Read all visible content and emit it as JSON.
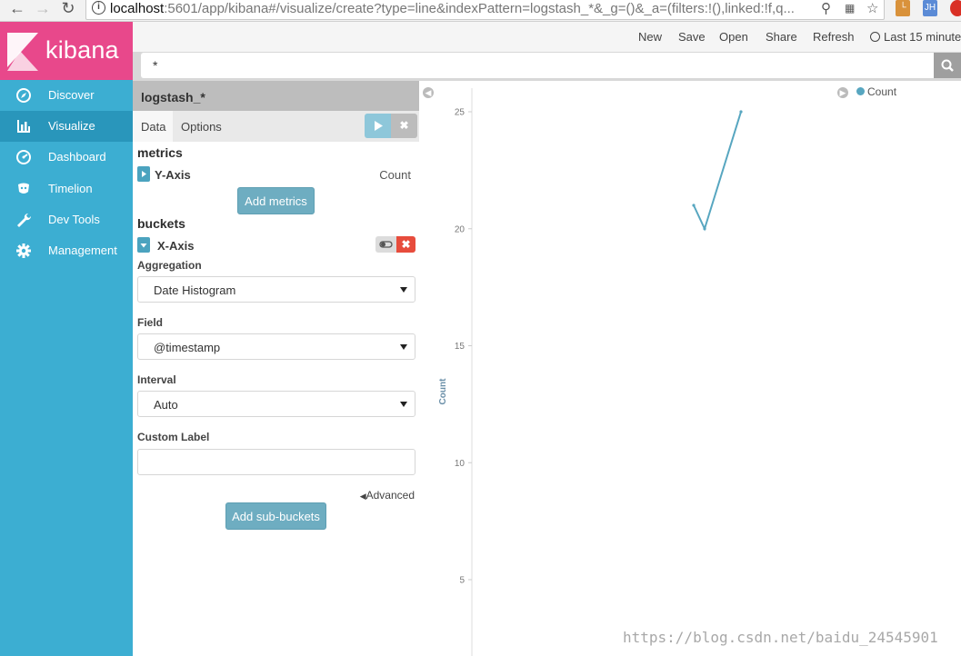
{
  "browser": {
    "url_host": "localhost",
    "url_path": ":5601/app/kibana#/visualize/create?type=line&indexPattern=logstash_*&_g=()&_a=(filters:!(),linked:!f,q...",
    "ext_label": "JH"
  },
  "app": {
    "brand": "kibana"
  },
  "sidebar": {
    "items": [
      {
        "label": "Discover",
        "icon": "compass-icon"
      },
      {
        "label": "Visualize",
        "icon": "bar-chart-icon"
      },
      {
        "label": "Dashboard",
        "icon": "dashboard-icon"
      },
      {
        "label": "Timelion",
        "icon": "timelion-icon"
      },
      {
        "label": "Dev Tools",
        "icon": "wrench-icon"
      },
      {
        "label": "Management",
        "icon": "gear-icon"
      }
    ],
    "active": "Visualize"
  },
  "topnav": {
    "new": "New",
    "save": "Save",
    "open": "Open",
    "share": "Share",
    "refresh": "Refresh",
    "time": "Last 15 minute"
  },
  "query": {
    "value": "*"
  },
  "editor": {
    "index_pattern": "logstash_*",
    "tabs": [
      "Data",
      "Options"
    ],
    "metrics_heading": "metrics",
    "y_axis_label": "Y-Axis",
    "y_axis_agg": "Count",
    "add_metrics": "Add metrics",
    "buckets_heading": "buckets",
    "x_axis_label": "X-Axis",
    "aggregation_label": "Aggregation",
    "aggregation_value": "Date Histogram",
    "field_label": "Field",
    "field_value": "@timestamp",
    "interval_label": "Interval",
    "interval_value": "Auto",
    "custom_label": "Custom Label",
    "custom_label_value": "",
    "advanced": "Advanced",
    "add_sub_buckets": "Add sub-buckets"
  },
  "chart_data": {
    "type": "line",
    "ylabel": "Count",
    "xlabel": "",
    "y_ticks": [
      5,
      10,
      15,
      20,
      25
    ],
    "series": [
      {
        "name": "Count",
        "values": [
          21,
          20,
          25
        ],
        "color": "#57a6c0"
      }
    ],
    "legend": "top-right"
  },
  "watermark": "https://blog.csdn.net/baidu_24545901",
  "colors": {
    "sidebar": "#3caed2",
    "logo": "#e8488b",
    "accent": "#6eadc1",
    "danger": "#e74c3c"
  }
}
